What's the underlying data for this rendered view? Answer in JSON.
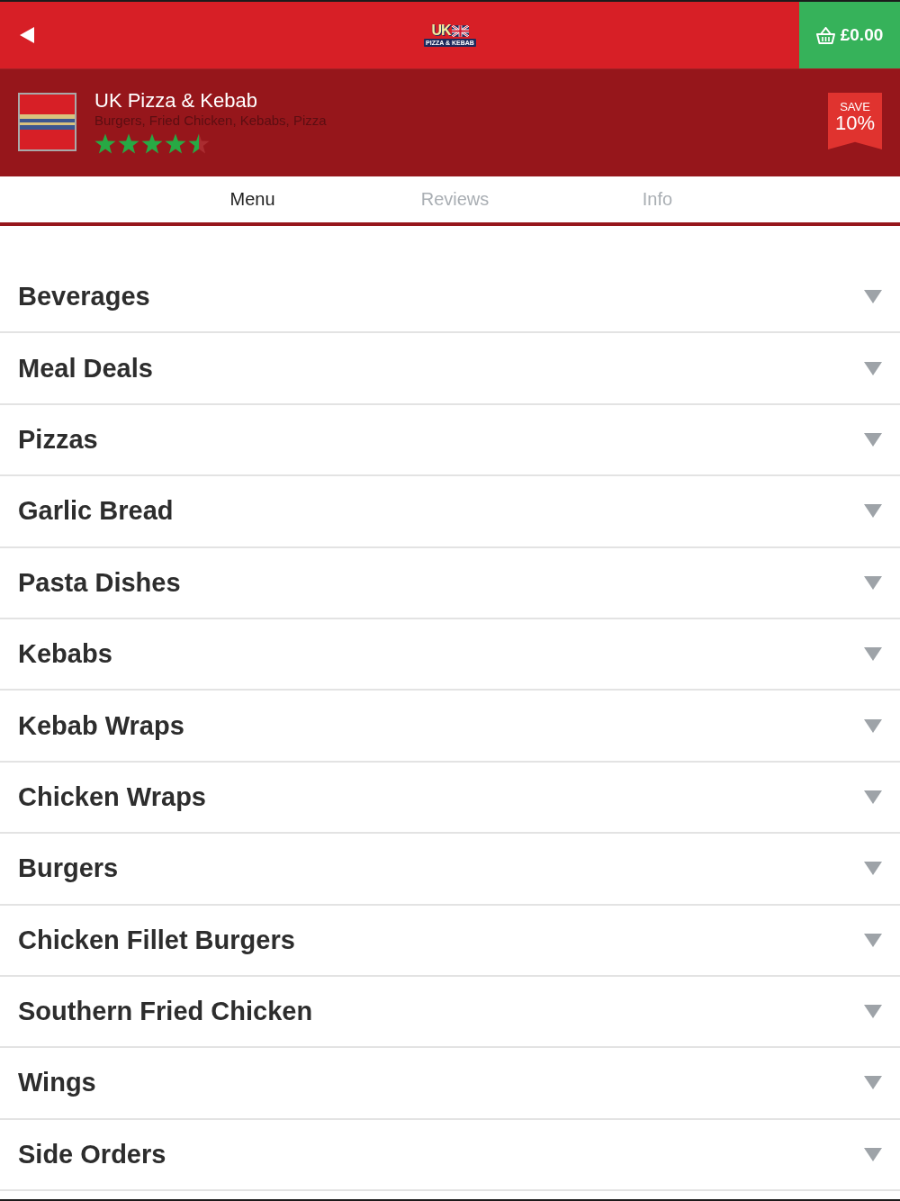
{
  "header": {
    "logo": {
      "title": "UK",
      "subtitle": "PIZZA & KEBAB"
    },
    "basket_total": "£0.00"
  },
  "restaurant": {
    "name": "UK Pizza & Kebab",
    "cuisines": "Burgers, Fried Chicken, Kebabs, Pizza",
    "stars": 4.5,
    "offer": {
      "label": "SAVE",
      "value": "10%"
    }
  },
  "tabs": [
    {
      "label": "Menu",
      "selected": true
    },
    {
      "label": "Reviews",
      "selected": false
    },
    {
      "label": "Info",
      "selected": false
    }
  ],
  "categories": [
    {
      "name": "Beverages",
      "expanded": false
    },
    {
      "name": "Meal Deals",
      "expanded": false
    },
    {
      "name": "Pizzas",
      "expanded": false
    },
    {
      "name": "Garlic Bread",
      "expanded": false
    },
    {
      "name": "Pasta Dishes",
      "expanded": false
    },
    {
      "name": "Kebabs",
      "expanded": false
    },
    {
      "name": "Kebab Wraps",
      "expanded": false
    },
    {
      "name": "Chicken Wraps",
      "expanded": false
    },
    {
      "name": "Burgers",
      "expanded": false
    },
    {
      "name": "Chicken Fillet Burgers",
      "expanded": false
    },
    {
      "name": "Southern Fried Chicken",
      "expanded": false
    },
    {
      "name": "Wings",
      "expanded": false
    },
    {
      "name": "Side Orders",
      "expanded": false
    }
  ]
}
